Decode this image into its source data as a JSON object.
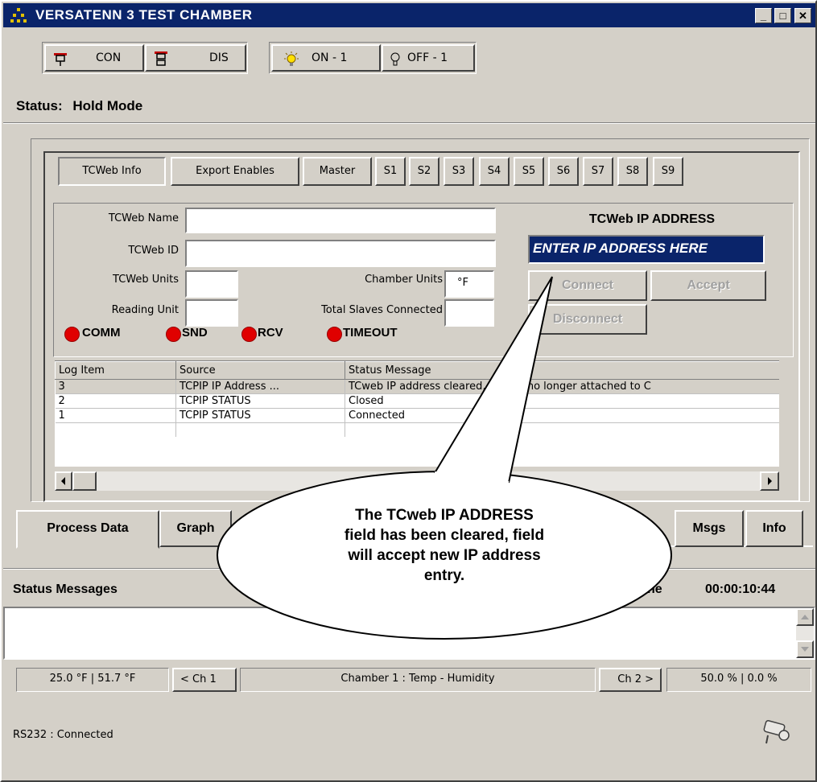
{
  "window": {
    "title": "VERSATENN 3 TEST CHAMBER",
    "controls": {
      "minimize": "_",
      "maximize": "□",
      "close": "✕"
    }
  },
  "toolbar": {
    "connect_label": "CON",
    "disconnect_label": "DIS",
    "on_label": "ON - 1",
    "off_label": "OFF - 1"
  },
  "status": {
    "label": "Status:",
    "value": "Hold Mode"
  },
  "tcweb_tabs": [
    "TCWeb Info",
    "Export Enables",
    "Master",
    "S1",
    "S2",
    "S3",
    "S4",
    "S5",
    "S6",
    "S7",
    "S8",
    "S9"
  ],
  "form": {
    "name_label": "TCWeb Name",
    "name_value": "",
    "id_label": "TCWeb ID",
    "id_value": "",
    "units_label": "TCWeb Units",
    "units_value": "",
    "chamber_units_label": "Chamber Units",
    "chamber_units_value": "°F",
    "reading_unit_label": "Reading Unit",
    "reading_unit_value": "",
    "total_slaves_label": "Total Slaves Connected",
    "total_slaves_value": "",
    "ip_heading": "TCWeb IP ADDRESS",
    "ip_value": "ENTER IP ADDRESS HERE",
    "connect_btn": "Connect",
    "accept_btn": "Accept",
    "disconnect_btn": "Disconnect"
  },
  "indicators": [
    {
      "label": "COMM",
      "color": "#e00000"
    },
    {
      "label": "SND",
      "color": "#e00000"
    },
    {
      "label": "RCV",
      "color": "#e00000"
    },
    {
      "label": "TIMEOUT",
      "color": "#e00000"
    }
  ],
  "log": {
    "columns": [
      "Log Item",
      "Source",
      "Status Message"
    ],
    "rows": [
      [
        "3",
        "TCPIP IP Address ...",
        "TCweb IP address cleared, TCweb no longer attached to C"
      ],
      [
        "2",
        "TCPIP STATUS",
        "Closed"
      ],
      [
        "1",
        "TCPIP STATUS",
        "Connected"
      ]
    ]
  },
  "bottom_tabs": {
    "process_data": "Process Data",
    "graph": "Graph",
    "msgs": "Msgs",
    "info": "Info"
  },
  "callout": {
    "line1": "The TCweb IP ADDRESS",
    "line2": "field has been cleared, field",
    "line3": "will accept new IP address",
    "line4": "entry."
  },
  "status_messages": {
    "title": "Status Messages",
    "time_label": "ne",
    "time_value": "00:00:10:44"
  },
  "statusbar": {
    "temps": "25.0 °F  |  51.7 °F",
    "prev_ch": "< Ch 1",
    "chamber": "Chamber 1 : Temp - Humidity",
    "next_ch": "Ch 2 >",
    "humidity": "50.0 %  |  0.0 %"
  },
  "footer": {
    "rs232": "RS232 : Connected"
  },
  "colors": {
    "titlebar": "#0a246a",
    "led_red": "#e00000",
    "ip_field_bg": "#0a246a",
    "face": "#d4d0c8"
  }
}
